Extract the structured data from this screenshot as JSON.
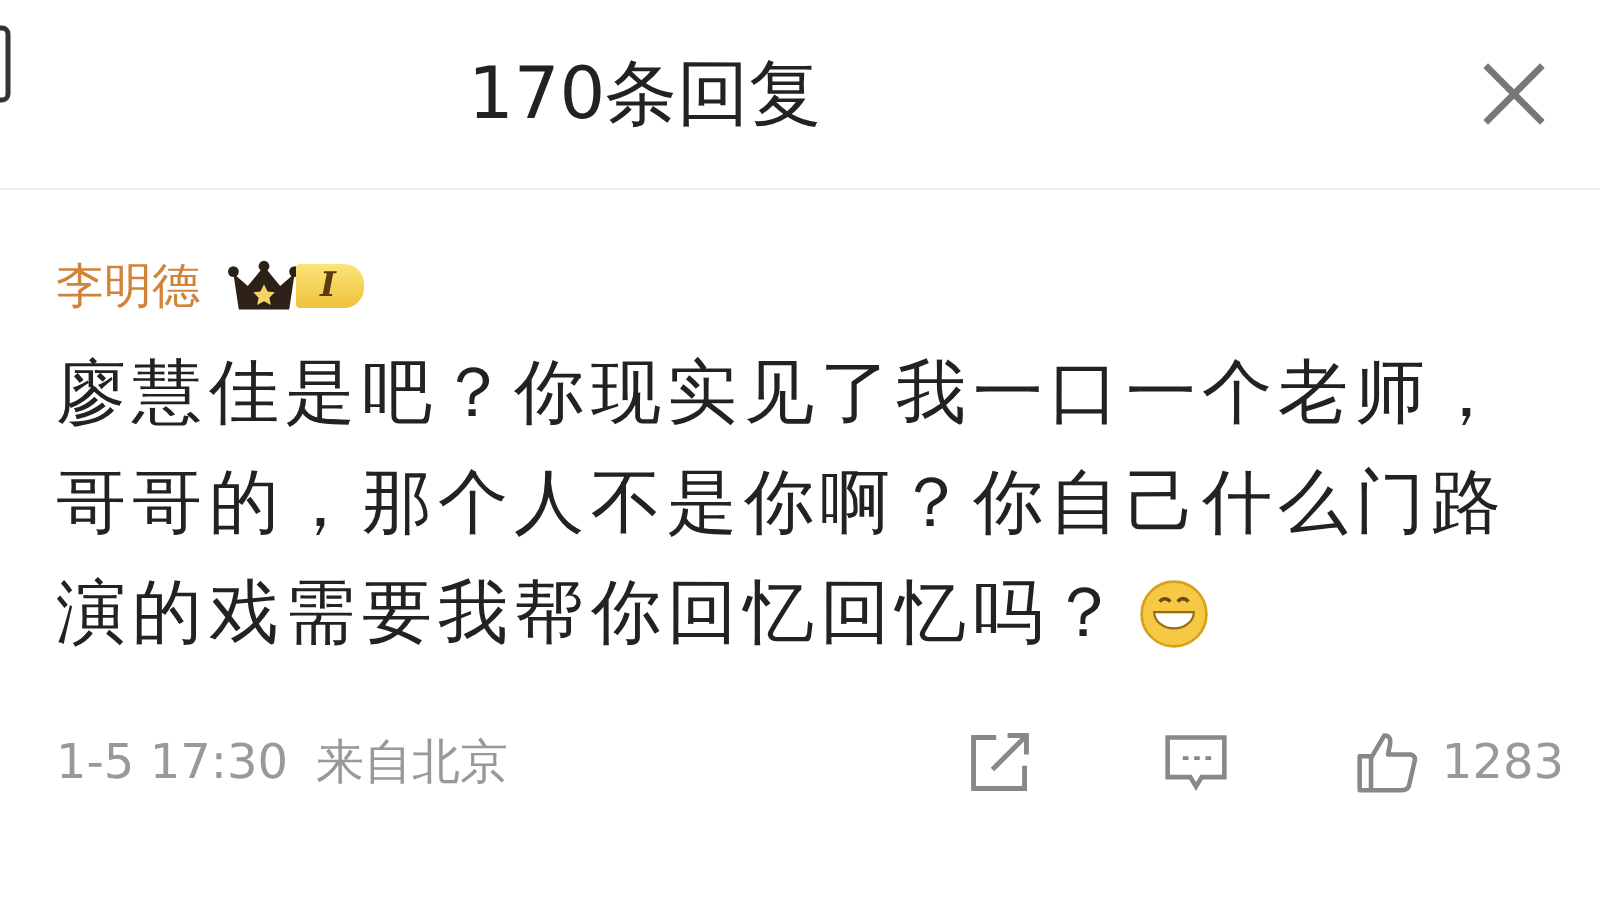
{
  "header": {
    "title": "170条回复"
  },
  "comment": {
    "author": "李明德",
    "badge": "I",
    "lines": [
      "廖慧佳是吧？你现实见了我一口一个老师，",
      "哥哥的，那个人不是你啊？你自己什么门路",
      "演的戏需要我帮你回忆回忆吗？"
    ],
    "time": "1-5 17:30",
    "source": "来自北京",
    "likes": "1283"
  }
}
